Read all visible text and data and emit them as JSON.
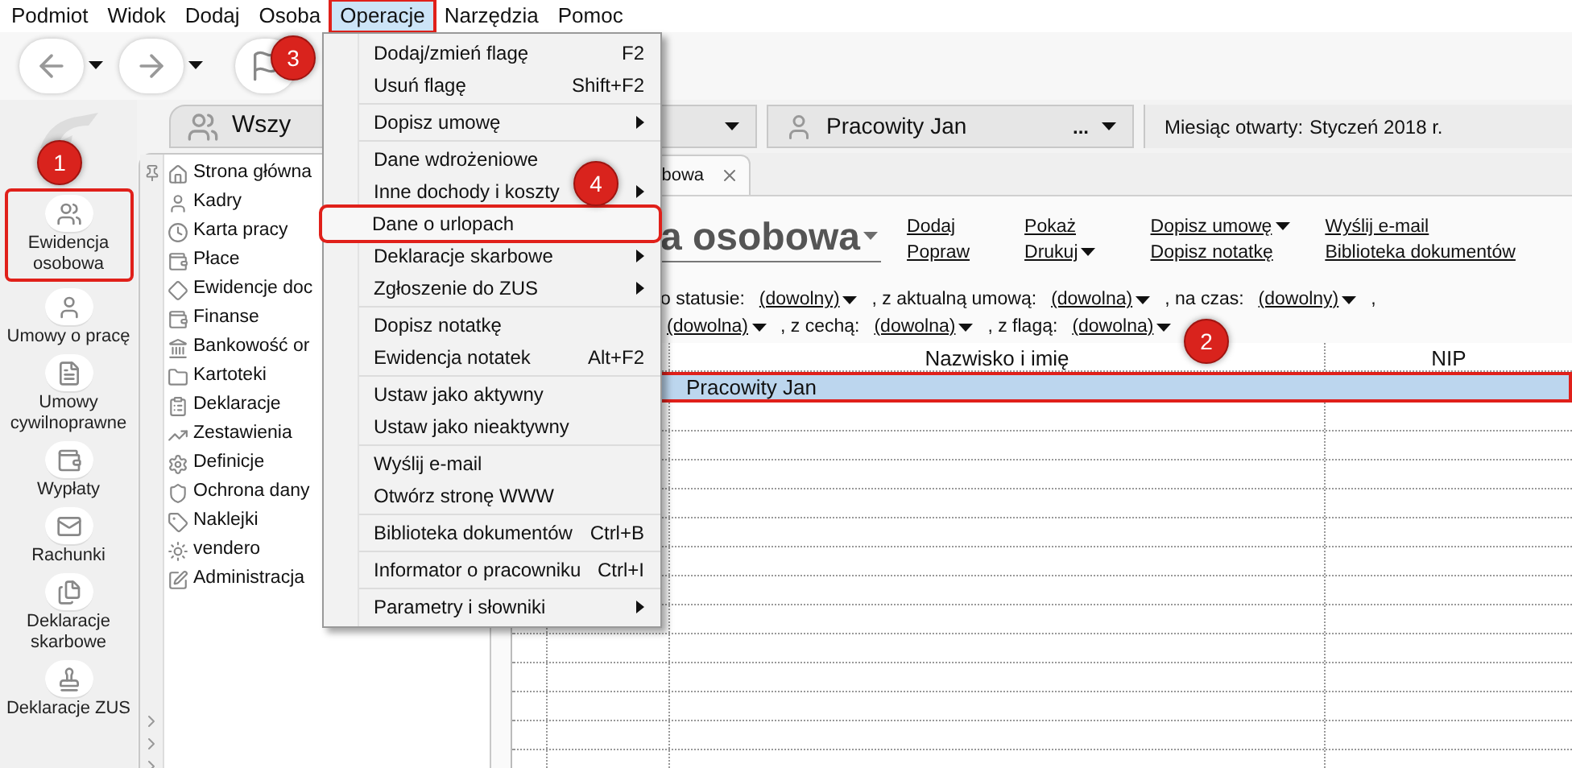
{
  "menu_bar": [
    {
      "label": "Podmiot",
      "selected": false
    },
    {
      "label": "Widok",
      "selected": false
    },
    {
      "label": "Dodaj",
      "selected": false
    },
    {
      "label": "Osoba",
      "selected": false
    },
    {
      "label": "Operacje",
      "selected": true
    },
    {
      "label": "Narzędzia",
      "selected": false
    },
    {
      "label": "Pomoc",
      "selected": false
    }
  ],
  "sidebar": {
    "items": [
      {
        "label": "Ewidencja osobowa",
        "selected": true
      },
      {
        "label": "Umowy o pracę",
        "selected": false
      },
      {
        "label": "Umowy cywilnoprawne",
        "selected": false
      },
      {
        "label": "Wypłaty",
        "selected": false
      },
      {
        "label": "Rachunki",
        "selected": false
      },
      {
        "label": "Deklaracje skarbowe",
        "selected": false
      },
      {
        "label": "Deklaracje ZUS",
        "selected": false
      }
    ]
  },
  "tree": {
    "header": "Wszy",
    "items": [
      "Strona główna",
      "Kadry",
      "Karta pracy",
      "Płace",
      "Ewidencje doc",
      "Finanse",
      "Bankowość or",
      "Kartoteki",
      "Deklaracje",
      "Zestawienia",
      "Definicje",
      "Ochrona dany",
      "Naklejki",
      "vendero",
      "Administracja"
    ]
  },
  "context_bar": {
    "person": "Pracowity Jan",
    "more": "...",
    "month_label": "Miesiąc otwarty:",
    "month": "Styczeń 2018 r."
  },
  "tab": {
    "label": "bowa"
  },
  "heading": "a osobowa",
  "actions": [
    {
      "label": "Dodaj",
      "dropdown": false
    },
    {
      "label": "Popraw",
      "dropdown": false
    },
    {
      "label": "Pokaż",
      "dropdown": false
    },
    {
      "label": "Drukuj",
      "dropdown": true
    },
    {
      "label": "Dopisz umowę",
      "dropdown": true
    },
    {
      "label": "Dopisz notatkę",
      "dropdown": false
    },
    {
      "label": "Wyślij e-mail",
      "dropdown": false
    },
    {
      "label": "Biblioteka dokumentów",
      "dropdown": false
    }
  ],
  "filters": [
    [
      {
        "kind": "text",
        "label": "o statusie:"
      },
      {
        "kind": "link",
        "label": "(dowolny)"
      },
      {
        "kind": "text",
        "label": ", z aktualną umową:"
      },
      {
        "kind": "link",
        "label": "(dowolna)"
      },
      {
        "kind": "text",
        "label": ", na czas:"
      },
      {
        "kind": "link",
        "label": "(dowolny)"
      },
      {
        "kind": "text",
        "label": ","
      }
    ],
    [
      {
        "kind": "link",
        "label": "(dowolna)"
      },
      {
        "kind": "text",
        "label": ", z cechą:"
      },
      {
        "kind": "link",
        "label": "(dowolna)"
      },
      {
        "kind": "text",
        "label": ", z flagą:"
      },
      {
        "kind": "link",
        "label": "(dowolna)"
      }
    ]
  ],
  "table": {
    "columns": [
      "Nazwisko i imię",
      "NIP"
    ],
    "rows": [
      {
        "name": "Pracowity Jan",
        "selected": true
      }
    ]
  },
  "operations_menu": {
    "items": [
      {
        "kind": "item",
        "label": "Dodaj/zmień flagę",
        "shortcut": "F2",
        "submenu": false,
        "selected": false
      },
      {
        "kind": "item",
        "label": "Usuń flagę",
        "shortcut": "Shift+F2",
        "submenu": false,
        "selected": false
      },
      {
        "kind": "separator"
      },
      {
        "kind": "item",
        "label": "Dopisz umowę",
        "submenu": true,
        "selected": false
      },
      {
        "kind": "separator"
      },
      {
        "kind": "item",
        "label": "Dane wdrożeniowe",
        "submenu": false,
        "selected": false
      },
      {
        "kind": "item",
        "label": "Inne dochody i koszty",
        "submenu": true,
        "selected": false
      },
      {
        "kind": "item",
        "label": "Dane o urlopach",
        "submenu": false,
        "selected": true
      },
      {
        "kind": "item",
        "label": "Deklaracje skarbowe",
        "submenu": true,
        "selected": false
      },
      {
        "kind": "item",
        "label": "Zgłoszenie do ZUS",
        "submenu": true,
        "selected": false
      },
      {
        "kind": "separator"
      },
      {
        "kind": "item",
        "label": "Dopisz notatkę",
        "submenu": false,
        "selected": false
      },
      {
        "kind": "item",
        "label": "Ewidencja notatek",
        "shortcut": "Alt+F2",
        "submenu": false,
        "selected": false
      },
      {
        "kind": "separator"
      },
      {
        "kind": "item",
        "label": "Ustaw jako aktywny",
        "submenu": false,
        "selected": false
      },
      {
        "kind": "item",
        "label": "Ustaw jako nieaktywny",
        "submenu": false,
        "selected": false
      },
      {
        "kind": "separator"
      },
      {
        "kind": "item",
        "label": "Wyślij e-mail",
        "submenu": false,
        "selected": false
      },
      {
        "kind": "item",
        "label": "Otwórz stronę WWW",
        "submenu": false,
        "selected": false
      },
      {
        "kind": "separator"
      },
      {
        "kind": "item",
        "label": "Biblioteka dokumentów",
        "shortcut": "Ctrl+B",
        "submenu": false,
        "selected": false
      },
      {
        "kind": "separator"
      },
      {
        "kind": "item",
        "label": "Informator o pracowniku",
        "shortcut": "Ctrl+I",
        "submenu": false,
        "selected": false
      },
      {
        "kind": "separator"
      },
      {
        "kind": "item",
        "label": "Parametry i słowniki",
        "submenu": true,
        "selected": false
      }
    ]
  },
  "annotations": [
    {
      "label": "1"
    },
    {
      "label": "2"
    },
    {
      "label": "3"
    },
    {
      "label": "4"
    }
  ]
}
